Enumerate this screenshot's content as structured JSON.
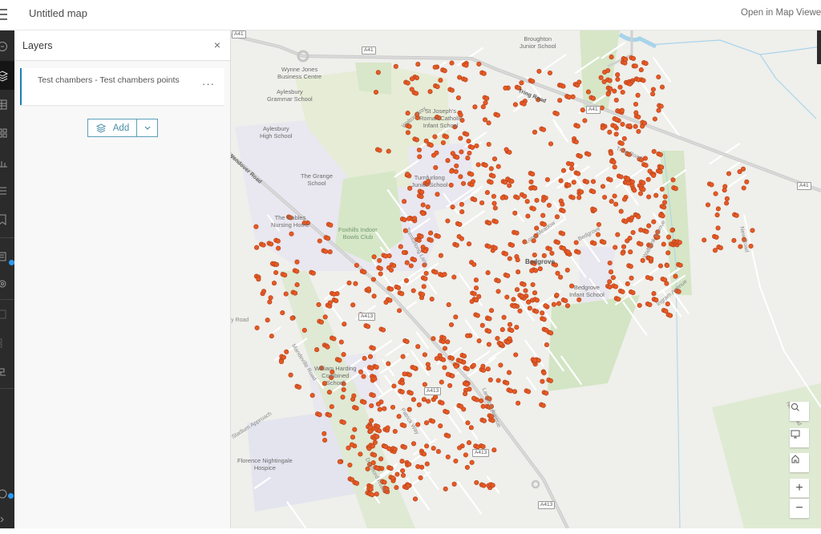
{
  "header": {
    "title": "Untitled map",
    "open_in_map_viewer": "Open in Map Viewer"
  },
  "action_bar": {
    "items": [
      {
        "name": "basemap",
        "icon": "circle-icon"
      },
      {
        "name": "layers",
        "icon": "layers-icon",
        "active": true
      },
      {
        "name": "tables",
        "icon": "table-icon"
      },
      {
        "name": "legend",
        "icon": "grid-icon"
      },
      {
        "name": "charts",
        "icon": "chart-icon"
      },
      {
        "name": "legend-list",
        "icon": "list-icon"
      },
      {
        "name": "bookmarks",
        "icon": "bookmark-icon"
      },
      {
        "name": "properties",
        "icon": "properties-icon"
      },
      {
        "name": "settings",
        "icon": "gear-icon"
      },
      {
        "name": "tool-a",
        "icon": "edit-icon"
      },
      {
        "name": "tool-b",
        "icon": "grid-icon"
      },
      {
        "name": "tool-c",
        "icon": "share-icon"
      },
      {
        "name": "tips",
        "icon": "info-icon"
      },
      {
        "name": "collapse",
        "icon": "chevron-right-icon"
      }
    ]
  },
  "layers_panel": {
    "title": "Layers",
    "close_glyph": "×",
    "layers": [
      {
        "name": "Test chambers - Test chambers points",
        "more_glyph": "···"
      }
    ],
    "add_label": "Add"
  },
  "map": {
    "point_color": "#e85a24",
    "labels": {
      "wynne_jones": "Wynne Jones\nBusiness Centre",
      "broughton": "Broughton\nJunior School",
      "aylesbury_grammar": "Aylesbury\nGrammar School",
      "st_josephs": "St Joseph's\nRoman Catholic\nInfant School",
      "aylesbury_high": "Aylesbury\nHigh School",
      "grange": "The Grange\nSchool",
      "turnfurlong": "Turnfurlong\nJunior School",
      "gables": "The Gables\nNursing Home",
      "foxhills": "Foxhills Indoor\nBowls Club",
      "bedgrove": "Bedgrove",
      "bedgrove_infant": "Bedgrove\nInfant School",
      "william_harding": "William Harding\nCombined\nSchool",
      "florence": "Florence Nightingale\nHospice"
    },
    "road_labels": {
      "walton_way": "Walton Way",
      "wendover_road": "Wendover Road",
      "tring_road": "Tring Road",
      "tring_road_2": "Tring Road",
      "new_road": "New Road",
      "new_road_2": "New Road",
      "stadium_approach": "Stadium Approach",
      "bay_road": "y Road",
      "turnfurlong_lane": "Turnfurlong Lane",
      "meadow": "Long Meadow",
      "bedgrove_road": "Bedgrove",
      "wellbank": "Walbank Avenue",
      "ingram": "Ingram Avenue",
      "langdon": "Langdon Avenue",
      "patrick": "Patrick Way",
      "dunsford": "Dunsford Road",
      "mandeville": "Mandeville Road"
    },
    "shields": {
      "a41_1": "A41",
      "a41_2": "A41",
      "a41_3": "A41",
      "a41_4": "A41",
      "a413_1": "A413",
      "a413_2": "A413",
      "a413_3": "A413",
      "a413_4": "A413"
    },
    "controls": {
      "search": "search-icon",
      "basemap": "monitor-icon",
      "home": "home-icon",
      "zoom_in": "+",
      "zoom_out": "−"
    }
  }
}
